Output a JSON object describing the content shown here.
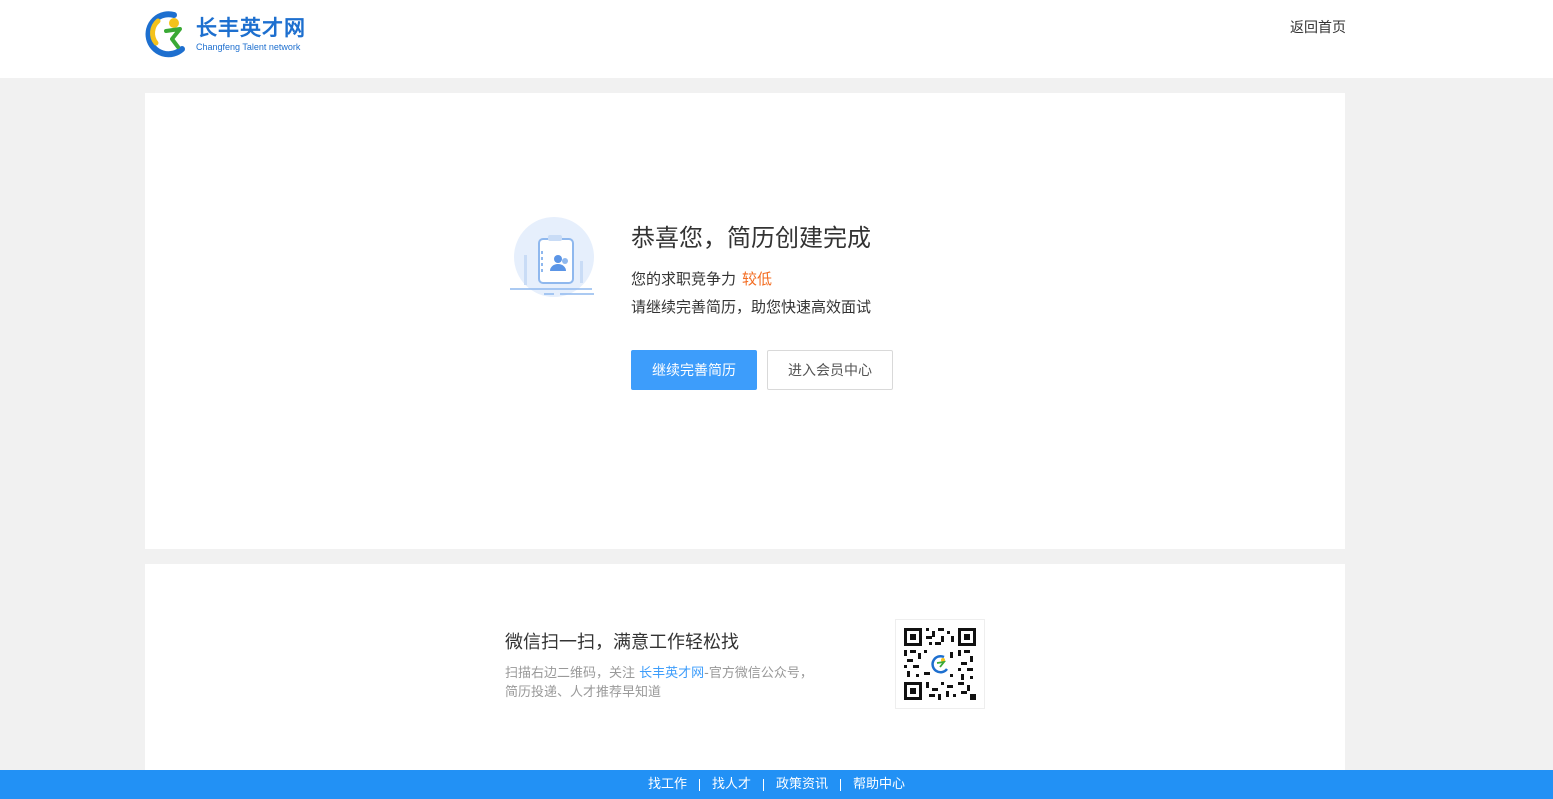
{
  "header": {
    "logo_cn": "长丰英才网",
    "logo_en": "Changfeng Talent network",
    "back_home": "返回首页"
  },
  "success": {
    "title": "恭喜您，简历创建完成",
    "competitiveness_label": "您的求职竞争力",
    "competitiveness_level": "较低",
    "hint": "请继续完善简历，助您快速高效面试",
    "btn_continue": "继续完善简历",
    "btn_member": "进入会员中心",
    "icon": "resume-contact-icon"
  },
  "qr_section": {
    "title": "微信扫一扫，满意工作轻松找",
    "desc_prefix": "扫描右边二维码，关注 ",
    "desc_brand": "长丰英才网",
    "desc_suffix": "-官方微信公众号，",
    "desc_line2": "简历投递、人才推荐早知道"
  },
  "footer": {
    "links": [
      "找工作",
      "找人才",
      "政策资讯",
      "帮助中心"
    ]
  },
  "colors": {
    "primary": "#3d9dfb",
    "footer_bg": "#2291f5",
    "warning": "#f36c21",
    "logo_blue": "#1d6fcf"
  }
}
